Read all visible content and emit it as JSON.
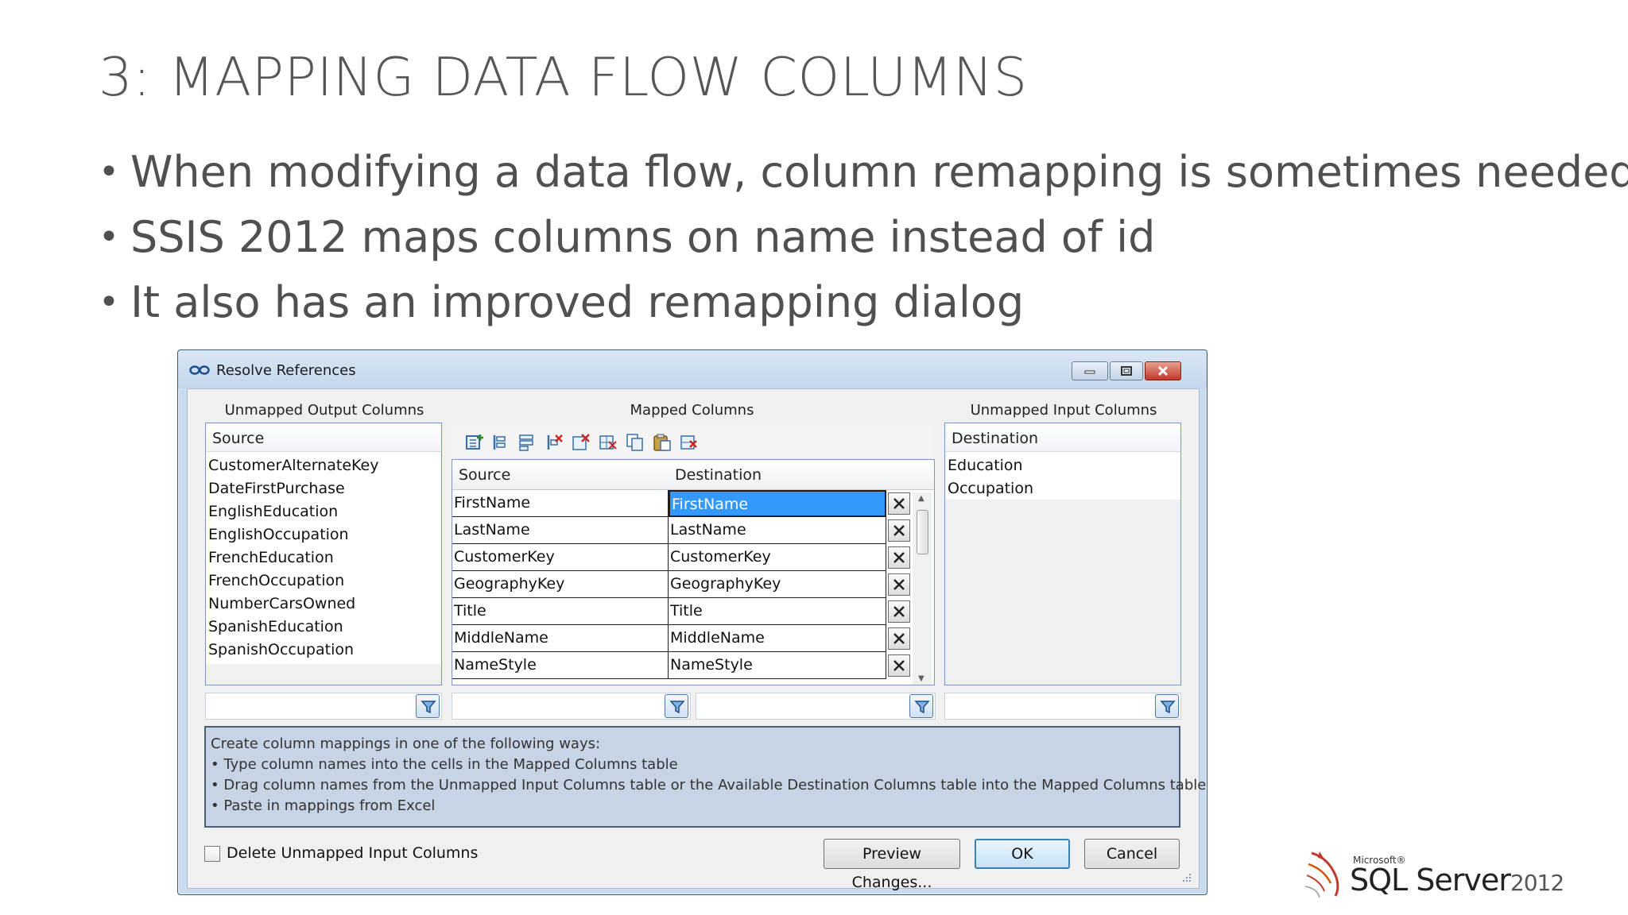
{
  "slide": {
    "title": "3: MAPPING DATA FLOW COLUMNS",
    "bullets": [
      "When modifying a data flow, column remapping is sometimes needed",
      "SSIS 2012 maps columns on name instead of id",
      "It also has an improved remapping dialog"
    ]
  },
  "dialog": {
    "title": "Resolve References",
    "unmapped_output": {
      "label": "Unmapped Output Columns",
      "header": "Source",
      "items": [
        "CustomerAlternateKey",
        "DateFirstPurchase",
        "EnglishEducation",
        "EnglishOccupation",
        "FrenchEducation",
        "FrenchOccupation",
        "NumberCarsOwned",
        "SpanishEducation",
        "SpanishOccupation"
      ]
    },
    "mapped": {
      "label": "Mapped Columns",
      "source_header": "Source",
      "destination_header": "Destination",
      "rows": [
        {
          "source": "FirstName",
          "destination": "FirstName"
        },
        {
          "source": "LastName",
          "destination": "LastName"
        },
        {
          "source": "CustomerKey",
          "destination": "CustomerKey"
        },
        {
          "source": "GeographyKey",
          "destination": "GeographyKey"
        },
        {
          "source": "Title",
          "destination": "Title"
        },
        {
          "source": "MiddleName",
          "destination": "MiddleName"
        },
        {
          "source": "NameStyle",
          "destination": "NameStyle"
        }
      ]
    },
    "unmapped_input": {
      "label": "Unmapped Input Columns",
      "header": "Destination",
      "items": [
        "Education",
        "Occupation"
      ]
    },
    "help": {
      "lines": [
        "Create column mappings in one of the following ways:",
        "• Type column names into the cells in the Mapped Columns table",
        "• Drag column names from the Unmapped Input Columns table or the Available Destination Columns table into the Mapped Columns table",
        "• Paste in mappings from Excel"
      ]
    },
    "delete_unmapped_label": "Delete Unmapped Input Columns",
    "buttons": {
      "preview": "Preview Changes...",
      "ok": "OK",
      "cancel": "Cancel"
    }
  },
  "logo": {
    "microsoft": "Microsoft®",
    "product": "SQL Server",
    "year": "2012"
  }
}
